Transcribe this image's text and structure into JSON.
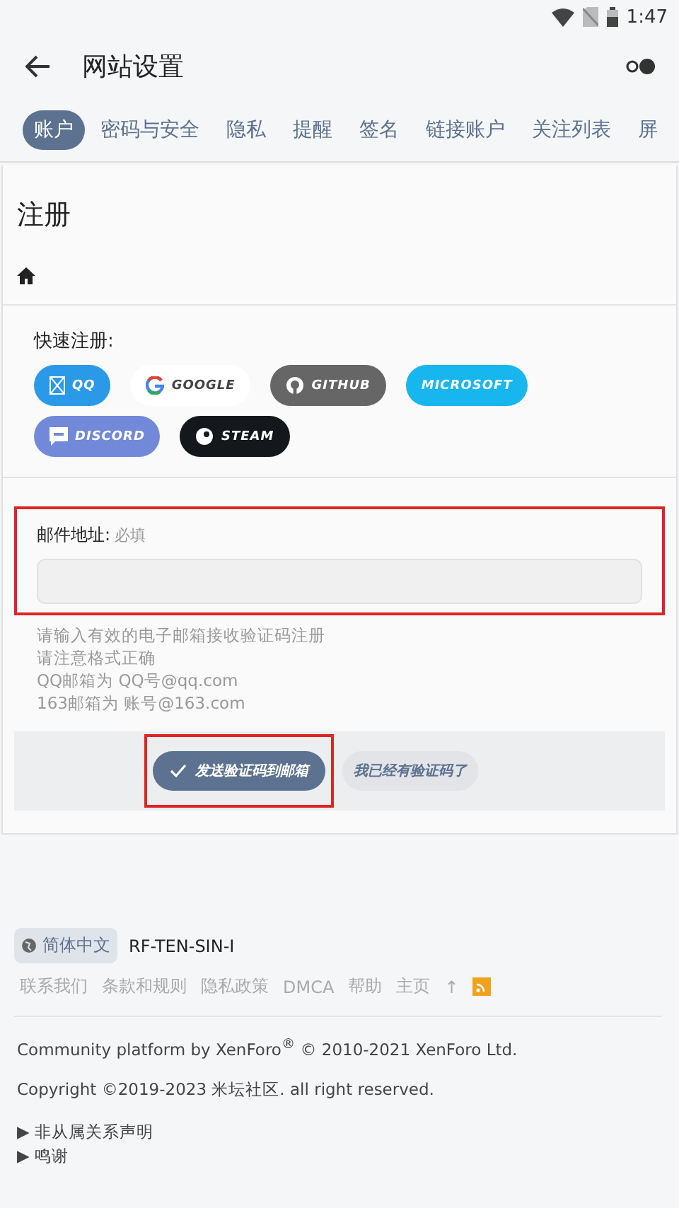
{
  "status_bar": {
    "time": "1:47"
  },
  "app_bar": {
    "title": "网站设置"
  },
  "tabs": [
    {
      "label": "账户",
      "selected": true
    },
    {
      "label": "密码与安全",
      "selected": false
    },
    {
      "label": "隐私",
      "selected": false
    },
    {
      "label": "提醒",
      "selected": false
    },
    {
      "label": "签名",
      "selected": false
    },
    {
      "label": "链接账户",
      "selected": false
    },
    {
      "label": "关注列表",
      "selected": false
    },
    {
      "label": "屏",
      "selected": false
    }
  ],
  "page_title": "注册",
  "quick_register": {
    "label": "快速注册:",
    "providers": [
      {
        "kind": "qq",
        "label": "QQ",
        "color": "#2a9ae8"
      },
      {
        "kind": "google",
        "label": "GOOGLE",
        "color": "#ffffff"
      },
      {
        "kind": "github",
        "label": "GITHUB",
        "color": "#666666"
      },
      {
        "kind": "microsoft",
        "label": "MICROSOFT",
        "color": "#17b6ee"
      },
      {
        "kind": "discord",
        "label": "DISCORD",
        "color": "#7289da"
      },
      {
        "kind": "steam",
        "label": "STEAM",
        "color": "#14171c"
      }
    ]
  },
  "email": {
    "label": "邮件地址:",
    "required": "必填",
    "highlighted": true,
    "hints": [
      "请输入有效的电子邮箱接收验证码注册",
      "请注意格式正确",
      "QQ邮箱为 QQ号@qq.com",
      "163邮箱为 账号@163.com"
    ]
  },
  "actions": {
    "send": {
      "label": "发送验证码到邮箱",
      "highlighted": true
    },
    "have_code": {
      "label": "我已经有验证码了"
    }
  },
  "footer": {
    "language": "简体中文",
    "style": "RF-TEN-SIN-I",
    "links": [
      "联系我们",
      "条款和规则",
      "隐私政策",
      "DMCA",
      "帮助",
      "主页",
      "↑"
    ],
    "platform": "Community platform by XenForo$^{®}$ © 2010-2021 XenForo Ltd.",
    "copyright": "Copyright ©2019-2023 米坛社区. all right reserved.",
    "details": [
      "▶ 非从属关系声明",
      "▶ 鸣谢"
    ]
  }
}
